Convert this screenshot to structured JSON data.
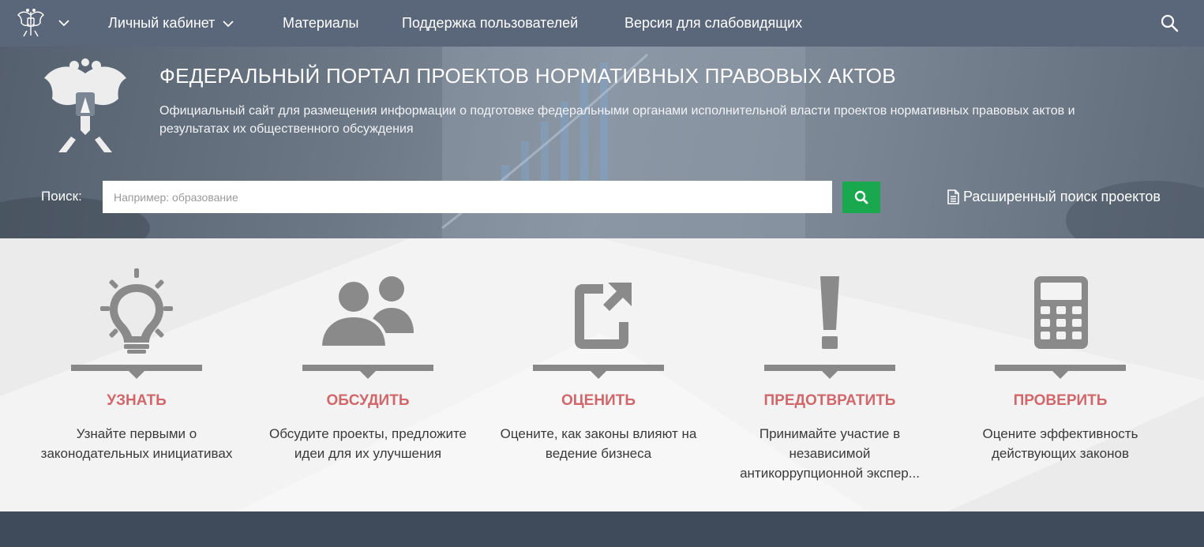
{
  "nav": {
    "account_label": "Личный кабинет",
    "materials_label": "Материалы",
    "support_label": "Поддержка пользователей",
    "accessibility_label": "Версия для слабовидящих"
  },
  "hero": {
    "title": "ФЕДЕРАЛЬНЫЙ ПОРТАЛ ПРОЕКТОВ НОРМАТИВНЫХ ПРАВОВЫХ АКТОВ",
    "subtitle": "Официальный сайт для размещения информации о подготовке федеральными органами исполнительной власти проектов нормативных правовых актов и результатах их общественного обсуждения"
  },
  "search": {
    "label": "Поиск:",
    "placeholder": "Например: образование",
    "advanced_label": "Расширенный поиск проектов"
  },
  "features": [
    {
      "title": "УЗНАТЬ",
      "desc": "Узнайте первыми о законодательных инициативах",
      "icon": "lightbulb-icon"
    },
    {
      "title": "ОБСУДИТЬ",
      "desc": "Обсудите проекты, предложите идеи для их улучшения",
      "icon": "people-icon"
    },
    {
      "title": "ОЦЕНИТЬ",
      "desc": "Оцените, как законы влияют на ведение бизнеса",
      "icon": "share-square-icon"
    },
    {
      "title": "ПРЕДОТВРАТИТЬ",
      "desc": "Принимайте участие в независимой антикоррупционной экспер...",
      "icon": "exclamation-icon"
    },
    {
      "title": "ПРОВЕРИТЬ",
      "desc": "Оцените эффективность действующих законов",
      "icon": "calculator-icon"
    }
  ],
  "colors": {
    "nav_bg": "#5a677a",
    "accent_green": "#1aa84f",
    "feature_title": "#d0676a",
    "icon_gray": "#8a8a8a",
    "footer_bg": "#3f4a5a"
  }
}
